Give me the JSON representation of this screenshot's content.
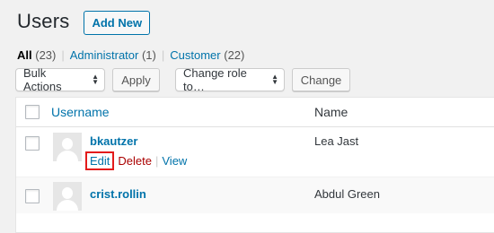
{
  "header": {
    "title": "Users",
    "add_new_label": "Add New"
  },
  "filters": {
    "all_label": "All",
    "all_count": "(23)",
    "administrator_label": "Administrator",
    "administrator_count": "(1)",
    "customer_label": "Customer",
    "customer_count": "(22)",
    "separator": "|"
  },
  "toolbar": {
    "bulk_actions": "Bulk Actions",
    "apply_label": "Apply",
    "change_role": "Change role to…",
    "change_label": "Change"
  },
  "table": {
    "columns": {
      "username": "Username",
      "name": "Name"
    },
    "rows": [
      {
        "username": "bkautzer",
        "name": "Lea Jast",
        "actions": {
          "edit": "Edit",
          "delete": "Delete",
          "view": "View",
          "separator": "|"
        }
      },
      {
        "username": "crist.rollin",
        "name": "Abdul Green"
      }
    ]
  },
  "icons": {
    "avatar": "default-avatar-icon",
    "select_arrows": "updown-arrows-icon"
  },
  "colors": {
    "link": "#0073aa",
    "delete": "#aa0000",
    "highlight": "#e31b1b"
  }
}
